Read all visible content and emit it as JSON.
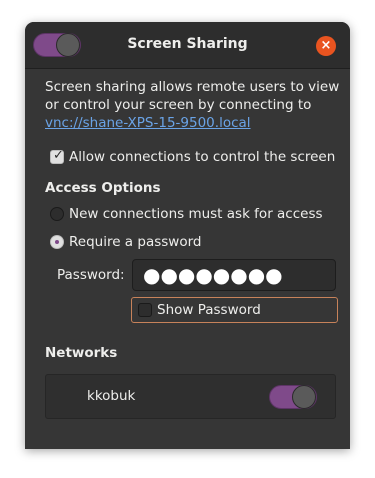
{
  "window": {
    "title": "Screen Sharing",
    "close_icon": "×"
  },
  "description": {
    "text": "Screen sharing allows remote users to view or control your screen by connecting to",
    "link": "vnc://shane-XPS-15-9500.local"
  },
  "allow_control": {
    "label": "Allow connections to control the screen",
    "checked": true
  },
  "access_options": {
    "title": "Access Options",
    "options": [
      {
        "label": "New connections must ask for access",
        "selected": false
      },
      {
        "label": "Require a password",
        "selected": true
      }
    ]
  },
  "password": {
    "label": "Password:",
    "value": "●●●●●●●●"
  },
  "show_password": {
    "label": "Show Password",
    "checked": false
  },
  "networks": {
    "title": "Networks",
    "items": [
      {
        "name": "kkobuk",
        "icon": "wifi-icon",
        "enabled": true
      }
    ]
  },
  "colors": {
    "accent": "#7f4a8a",
    "close": "#e95420",
    "link": "#6aa3e6",
    "background": "#363636"
  }
}
